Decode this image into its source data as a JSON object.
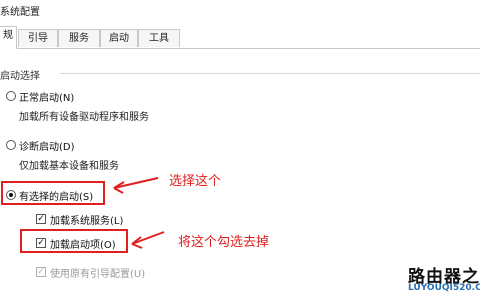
{
  "window": {
    "title": "系统配置"
  },
  "tabs": [
    {
      "label": "规",
      "active": true
    },
    {
      "label": "引导",
      "active": false
    },
    {
      "label": "服务",
      "active": false
    },
    {
      "label": "启动",
      "active": false
    },
    {
      "label": "工具",
      "active": false
    }
  ],
  "startup_selection": {
    "group_label": "启动选择",
    "options": [
      {
        "label": "正常启动(N)",
        "description": "加载所有设备驱动程序和服务",
        "selected": false
      },
      {
        "label": "诊断启动(D)",
        "description": "仅加载基本设备和服务",
        "selected": false
      },
      {
        "label": "有选择的启动(S)",
        "selected": true
      }
    ],
    "checkboxes": [
      {
        "label": "加载系统服务(L)",
        "checked": true,
        "enabled": true
      },
      {
        "label": "加载启动项(O)",
        "checked": true,
        "enabled": true
      },
      {
        "label": "使用原有引导配置(U)",
        "checked": true,
        "enabled": false
      }
    ]
  },
  "annotations": {
    "select_this": "选择这个",
    "uncheck_this": "将这个勾选去掉",
    "color": "#e02020"
  },
  "watermark": {
    "main": "路由器之家",
    "sub": "LUYOUQI520.COM"
  }
}
